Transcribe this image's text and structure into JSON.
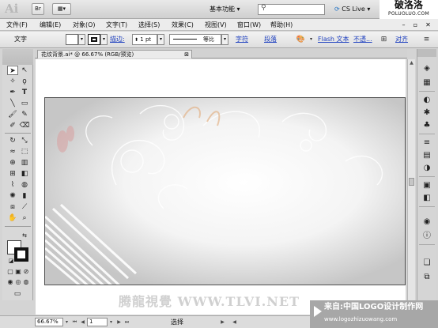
{
  "app": {
    "logo": "Ai"
  },
  "titlebar": {
    "workspace": "基本功能",
    "cs_live": "CS Live",
    "watermark_title": "破洛洛",
    "watermark_url": "POLUOLUO.COM"
  },
  "menubar": {
    "items": [
      {
        "label": "文件(F)"
      },
      {
        "label": "编辑(E)"
      },
      {
        "label": "对象(O)"
      },
      {
        "label": "文字(T)"
      },
      {
        "label": "选择(S)"
      },
      {
        "label": "效果(C)"
      },
      {
        "label": "视图(V)"
      },
      {
        "label": "窗口(W)"
      },
      {
        "label": "帮助(H)"
      }
    ]
  },
  "controlbar": {
    "mode_label": "文字",
    "stroke_label": "描边:",
    "stroke_weight": "1 pt",
    "stroke_profile": "等比",
    "char_link": "字符",
    "para_link": "段落",
    "flash_link": "Flash 文本",
    "opacity_link": "不透...",
    "align_link": "对齐"
  },
  "document": {
    "tab_title": "花纹背景.ai* @ 66.67% (RGB/预览)"
  },
  "statusbar": {
    "zoom": "66.67%",
    "artboard": "1",
    "tool": "选择"
  },
  "watermarks": {
    "center": "腾龍視覺 WWW.TLVI.NET",
    "bottom_line1": "来自:中国LOGO设计制作网",
    "bottom_line2": "www.logozhizuowang.com"
  }
}
